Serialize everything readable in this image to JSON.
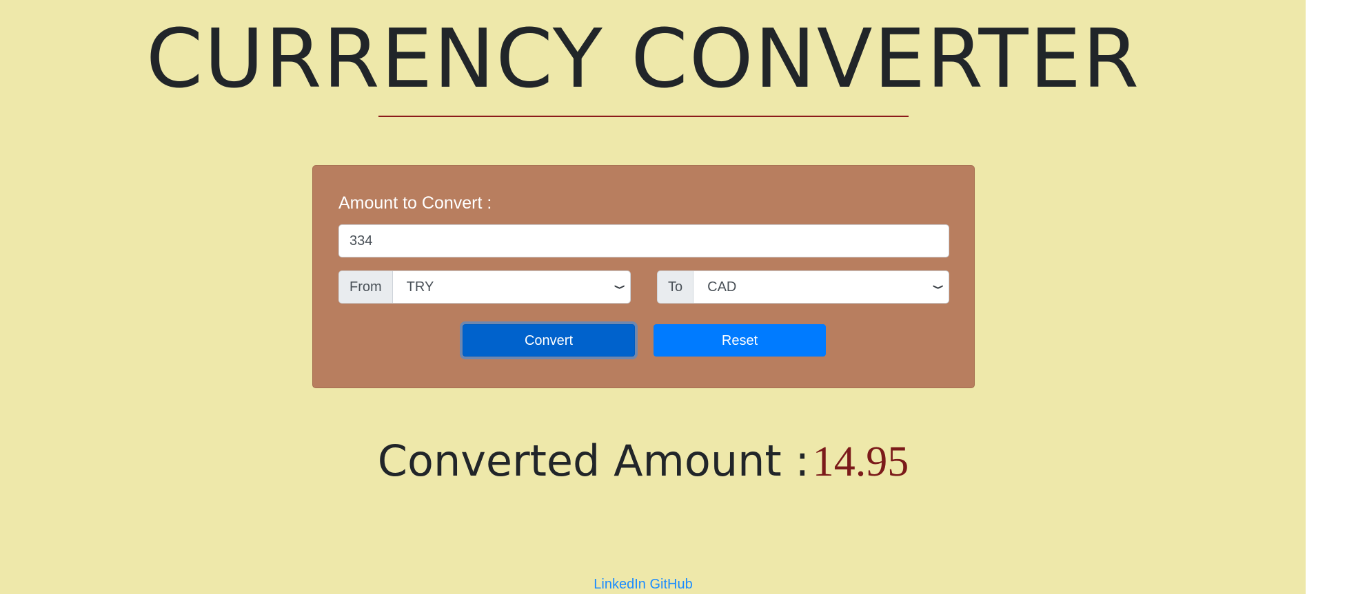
{
  "header": {
    "title": "CURRENCY CONVERTER"
  },
  "form": {
    "amount_label": "Amount to Convert :",
    "amount_value": "334",
    "from_label": "From",
    "from_value": "TRY",
    "to_label": "To",
    "to_value": "CAD",
    "convert_label": "Convert",
    "reset_label": "Reset"
  },
  "result": {
    "label": "Converted Amount :",
    "value": "14.95"
  },
  "footer": {
    "linkedin_label": "LinkedIn",
    "github_label": "GitHub"
  },
  "colors": {
    "background": "#eee8aa",
    "card": "#b87e5f",
    "accent": "#007bff",
    "result_value": "#7b1a1a"
  }
}
